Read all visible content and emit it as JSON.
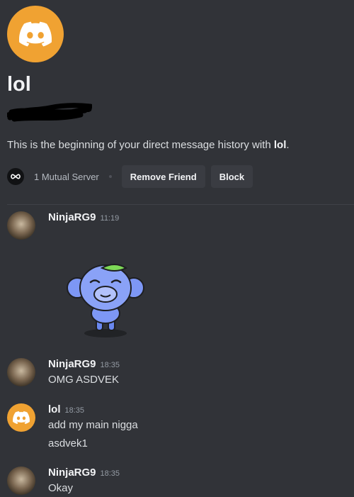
{
  "intro": {
    "title": "lol",
    "text_prefix": "This is the beginning of your direct message history with ",
    "text_name": "lol",
    "text_suffix": ".",
    "mutual_servers": "1 Mutual Server",
    "remove_friend": "Remove Friend",
    "block": "Block"
  },
  "messages": [
    {
      "author": "NinjaRG9",
      "time": "11:19",
      "avatar": "ninja-avatar",
      "lines": [],
      "sticker": "wumpus-sticker"
    },
    {
      "author": "NinjaRG9",
      "time": "18:35",
      "avatar": "ninja-avatar",
      "lines": [
        "OMG ASDVEK"
      ]
    },
    {
      "author": "lol",
      "time": "18:35",
      "avatar": "discord-avatar",
      "lines": [
        "add my main nigga",
        "asdvek1"
      ]
    },
    {
      "author": "NinjaRG9",
      "time": "18:35",
      "avatar": "ninja-avatar",
      "lines": [
        "Okay"
      ]
    }
  ],
  "colors": {
    "background": "#313338",
    "accent_avatar": "#f0a232",
    "button": "#3a3c42"
  }
}
